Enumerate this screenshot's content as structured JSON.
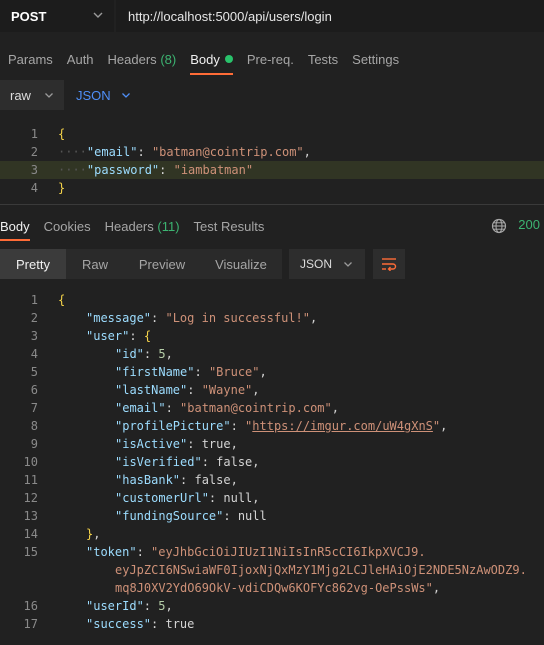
{
  "request": {
    "method": "POST",
    "url": "http://localhost:5000/api/users/login"
  },
  "request_tabs": [
    {
      "label": "Params"
    },
    {
      "label": "Auth"
    },
    {
      "label": "Headers",
      "count": "(8)"
    },
    {
      "label": "Body",
      "active": true
    },
    {
      "label": "Pre-req."
    },
    {
      "label": "Tests"
    },
    {
      "label": "Settings"
    }
  ],
  "body_format": {
    "mode": "raw",
    "language": "JSON"
  },
  "request_body": {
    "line_numbers": [
      "1",
      "2",
      "3",
      "4"
    ],
    "open_brace": "{",
    "close_brace": "}",
    "email_key": "\"email\"",
    "email_value": "\"batman@cointrip.com\"",
    "password_key": "\"password\"",
    "password_value": "\"iambatman\""
  },
  "response_tabs": [
    {
      "label": "Body",
      "active": true
    },
    {
      "label": "Cookies"
    },
    {
      "label": "Headers",
      "count": "(11)"
    },
    {
      "label": "Test Results"
    }
  ],
  "status_code": "200",
  "response_views": [
    "Pretty",
    "Raw",
    "Preview",
    "Visualize"
  ],
  "response_format": "JSON",
  "response_body": {
    "line_numbers": [
      "1",
      "2",
      "3",
      "4",
      "5",
      "6",
      "7",
      "8",
      "9",
      "10",
      "11",
      "12",
      "13",
      "14",
      "15",
      "16",
      "17"
    ],
    "message_key": "\"message\"",
    "message_value": "\"Log in successful!\"",
    "user_key": "\"user\"",
    "id_key": "\"id\"",
    "id_value": "5",
    "firstName_key": "\"firstName\"",
    "firstName_value": "\"Bruce\"",
    "lastName_key": "\"lastName\"",
    "lastName_value": "\"Wayne\"",
    "email_key": "\"email\"",
    "email_value": "\"batman@cointrip.com\"",
    "profilePicture_key": "\"profilePicture\"",
    "profilePicture_value": "https://imgur.com/uW4gXnS",
    "isActive_key": "\"isActive\"",
    "isActive_value": "true",
    "isVerified_key": "\"isVerified\"",
    "isVerified_value": "false",
    "hasBank_key": "\"hasBank\"",
    "hasBank_value": "false",
    "customerUrl_key": "\"customerUrl\"",
    "customerUrl_value": "null",
    "fundingSource_key": "\"fundingSource\"",
    "fundingSource_value": "null",
    "token_key": "\"token\"",
    "token_line1": "\"eyJhbGciOiJIUzI1NiIsInR5cCI6IkpXVCJ9.",
    "token_line2": "eyJpZCI6NSwiaWF0IjoxNjQxMzY1Mjg2LCJleHAiOjE2NDE5NzAwODZ9.",
    "token_line3": "mq8J0XV2YdO69OkV-vdiCDQw6KOFYc862vg-OePssWs\"",
    "userId_key": "\"userId\"",
    "userId_value": "5",
    "success_key": "\"success\"",
    "success_value": "true"
  }
}
